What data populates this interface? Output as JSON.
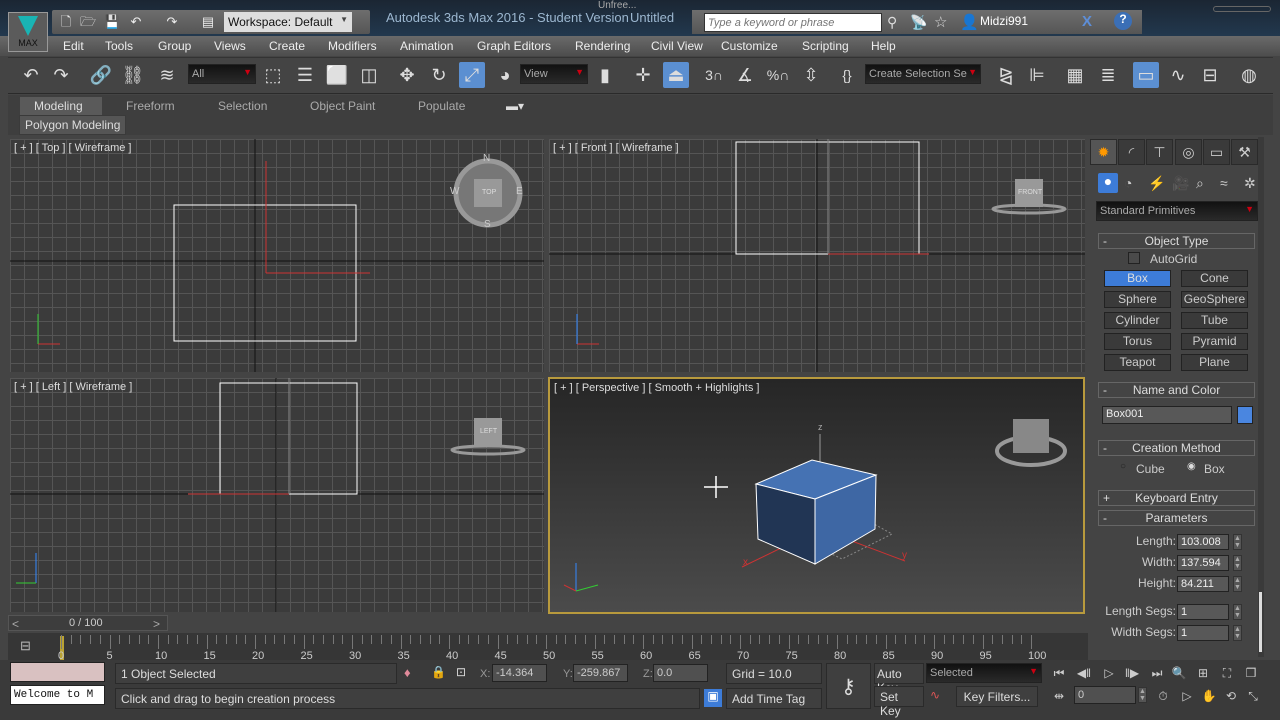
{
  "title_bar": {
    "logo_label": "MAX",
    "workspace": "Workspace: Default",
    "app_title": "Autodesk 3ds Max 2016 - Student Version",
    "document_name": "Untitled",
    "overlay_text": "Unfree...",
    "search_placeholder": "Type a keyword or phrase",
    "username": "Midzi991"
  },
  "menu": [
    "Edit",
    "Tools",
    "Group",
    "Views",
    "Create",
    "Modifiers",
    "Animation",
    "Graph Editors",
    "Rendering",
    "Civil View",
    "Customize",
    "Scripting",
    "Help"
  ],
  "toolbar": {
    "selection_filter": "All",
    "reference_coord": "View",
    "snap_toggle_label": "3",
    "percent_snap_label": "%",
    "named_selection": "Create Selection Se"
  },
  "ribbon": {
    "tabs": [
      "Modeling",
      "Freeform",
      "Selection",
      "Object Paint",
      "Populate"
    ],
    "panel_label": "Polygon Modeling"
  },
  "viewports": {
    "top": "[ + ] [ Top ] [ Wireframe ]",
    "front": "[ + ] [ Front ] [ Wireframe ]",
    "left": "[ + ] [ Left ] [ Wireframe ]",
    "perspective": "[ + ] [ Perspective ] [ Smooth + Highlights ]",
    "viewcube_top": "TOP",
    "viewcube_front": "FRONT",
    "viewcube_left": "LEFT",
    "compass": {
      "n": "N",
      "s": "S",
      "e": "E",
      "w": "W"
    },
    "axes": {
      "x": "x",
      "y": "y",
      "z": "z"
    }
  },
  "command_panel": {
    "category": "Standard Primitives",
    "object_type": {
      "title": "Object Type",
      "autogrid": "AutoGrid",
      "autogrid_checked": false,
      "buttons": [
        "Box",
        "Cone",
        "Sphere",
        "GeoSphere",
        "Cylinder",
        "Tube",
        "Torus",
        "Pyramid",
        "Teapot",
        "Plane"
      ],
      "active": "Box"
    },
    "name_and_color": {
      "title": "Name and Color",
      "name": "Box001",
      "color": "#4a86e0"
    },
    "creation_method": {
      "title": "Creation Method",
      "options": [
        "Cube",
        "Box"
      ],
      "selected": "Box"
    },
    "keyboard_entry": "Keyboard Entry",
    "parameters": {
      "title": "Parameters",
      "length_label": "Length:",
      "length": "103.008",
      "width_label": "Width:",
      "width": "137.594",
      "height_label": "Height:",
      "height": "84.211",
      "length_segs_label": "Length Segs:",
      "length_segs": "1",
      "width_segs_label": "Width Segs:",
      "width_segs": "1"
    }
  },
  "timeline": {
    "frame_display": "0 / 100",
    "prev": "<",
    "next": ">",
    "ticks": [
      "0",
      "5",
      "10",
      "15",
      "20",
      "25",
      "30",
      "35",
      "40",
      "45",
      "50",
      "55",
      "60",
      "65",
      "70",
      "75",
      "80",
      "85",
      "90",
      "95",
      "100"
    ]
  },
  "status": {
    "maxscript": "Welcome to M",
    "selection": "1 Object Selected",
    "prompt": "Click and drag to begin creation process",
    "x_label": "X:",
    "x": "-14.364",
    "y_label": "Y:",
    "y": "-259.867",
    "z_label": "Z:",
    "z": "0.0",
    "grid": "Grid = 10.0",
    "add_time_tag": "Add Time Tag",
    "auto_key": "Auto Key",
    "set_key": "Set Key",
    "key_mode": "Selected",
    "key_filters": "Key Filters...",
    "current_frame": "0"
  }
}
